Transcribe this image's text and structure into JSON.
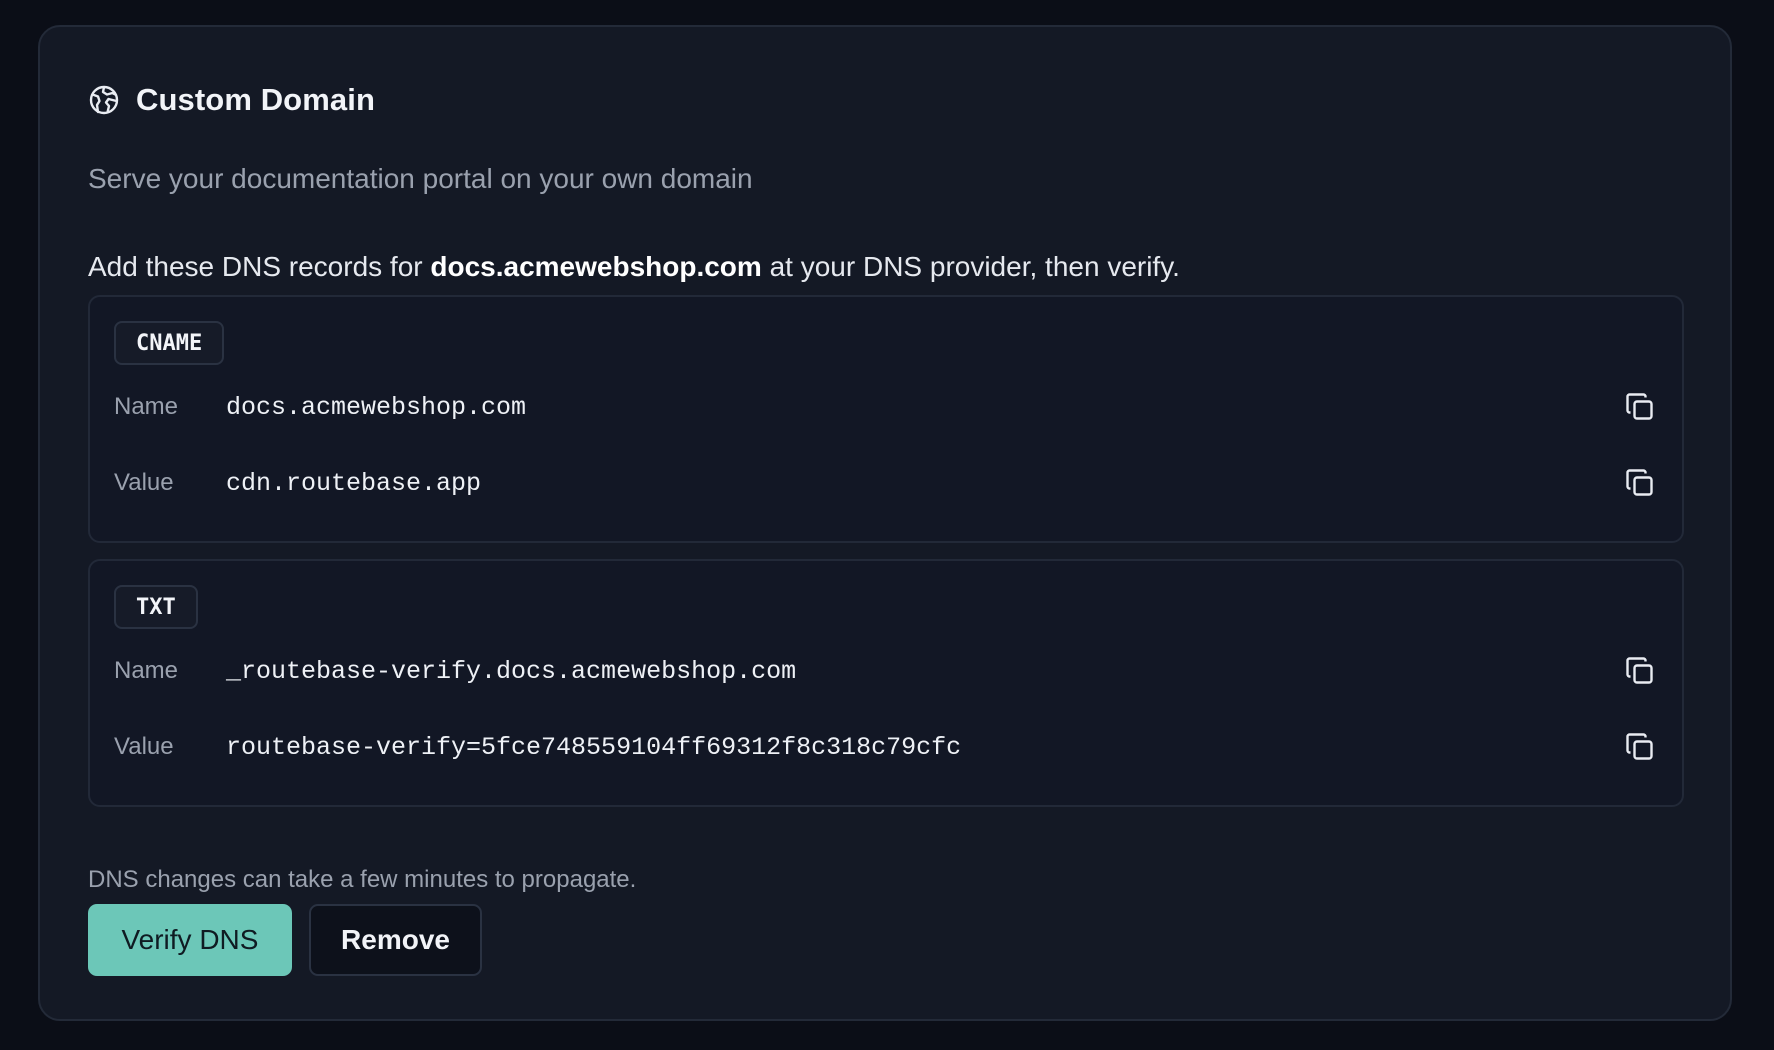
{
  "card": {
    "icon": "globe-icon",
    "title": "Custom Domain",
    "subtitle": "Serve your documentation portal on your own domain",
    "instructions": {
      "prefix": "Add these DNS records for ",
      "domain": "docs.acmewebshop.com",
      "suffix": " at your DNS provider, then verify."
    },
    "records": [
      {
        "type": "CNAME",
        "name_label": "Name",
        "name_value": "docs.acmewebshop.com",
        "value_label": "Value",
        "value_value": "cdn.routebase.app"
      },
      {
        "type": "TXT",
        "name_label": "Name",
        "name_value": "_routebase-verify.docs.acmewebshop.com",
        "value_label": "Value",
        "value_value": "routebase-verify=5fce748559104ff69312f8c318c79cfc"
      }
    ],
    "note": "DNS changes can take a few minutes to propagate.",
    "verify_label": "Verify DNS",
    "remove_label": "Remove"
  },
  "colors": {
    "background": "#0b0e17",
    "card": "#141925",
    "accent": "#6cc7b8",
    "text_primary": "#f2f4f8",
    "text_muted": "#9aa1ae"
  }
}
